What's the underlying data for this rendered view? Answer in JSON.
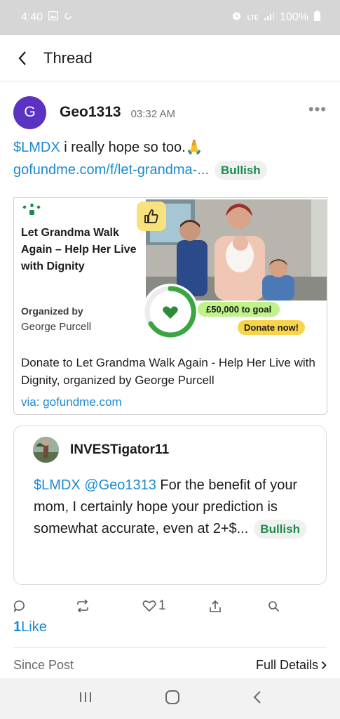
{
  "status_bar": {
    "time": "4:40",
    "network": "LTE",
    "battery": "100%"
  },
  "header": {
    "title": "Thread"
  },
  "post": {
    "avatar_letter": "G",
    "username": "Geo1313",
    "time": "03:32 AM",
    "cashtag": "$LMDX",
    "text": " i really hope so too.🙏",
    "link": "gofundme.com/f/let-grandma-...",
    "sentiment": "Bullish"
  },
  "preview": {
    "campaign_title": "Let Grandma Walk Again – Help Her Live with Dignity",
    "organized_by_label": "Organized by",
    "organizer": "George Purcell",
    "goal": "£50,000 to goal",
    "donate": "Donate now!",
    "description": "Donate to Let Grandma Walk Again - Help Her Live with Dignity, organized by George Purcell",
    "via": "via: gofundme.com"
  },
  "quote": {
    "username": "INVESTigator11",
    "cashtag": "$LMDX",
    "mention": "@Geo1313",
    "text": " For the benefit of your mom, I certainly hope your prediction is somewhat accurate, even at 2+$...",
    "sentiment": "Bullish"
  },
  "actions": {
    "like_count": "1",
    "likes_number": "1",
    "likes_label": "Like"
  },
  "footer": {
    "since_post": "Since Post",
    "full_details": "Full Details"
  },
  "colors": {
    "accent": "#1c8ad0",
    "bullish": "#1e8a4c",
    "avatar": "#5b32c2"
  }
}
